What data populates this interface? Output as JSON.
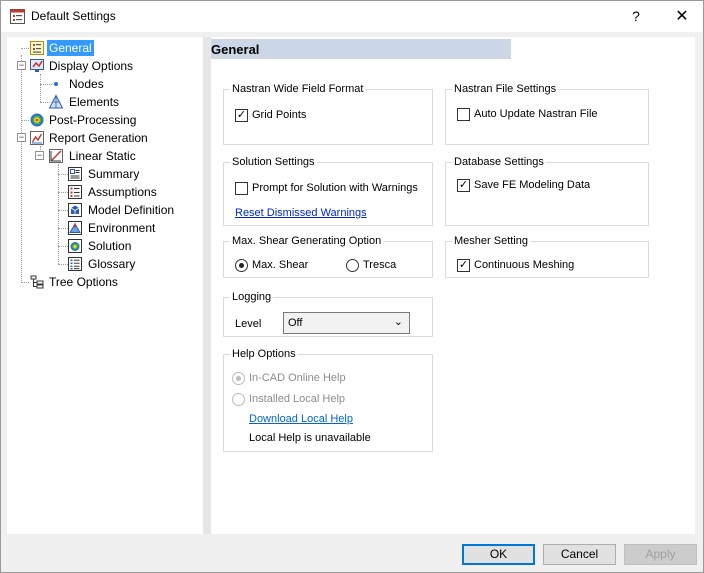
{
  "window": {
    "title": "Default Settings",
    "help_glyph": "?",
    "close_glyph": "✕"
  },
  "tree": {
    "items": [
      {
        "label": "General",
        "icon": "general-settings-icon",
        "selected": true
      },
      {
        "label": "Display Options",
        "icon": "display-options-icon"
      },
      {
        "label": "Nodes",
        "icon": "node-dot-icon"
      },
      {
        "label": "Elements",
        "icon": "elements-icon"
      },
      {
        "label": "Post-Processing",
        "icon": "post-processing-icon"
      },
      {
        "label": "Report Generation",
        "icon": "report-generation-icon"
      },
      {
        "label": "Linear Static",
        "icon": "linear-static-icon"
      },
      {
        "label": "Summary",
        "icon": "summary-icon"
      },
      {
        "label": "Assumptions",
        "icon": "assumptions-icon"
      },
      {
        "label": "Model Definition",
        "icon": "model-definition-icon"
      },
      {
        "label": "Environment",
        "icon": "environment-icon"
      },
      {
        "label": "Solution",
        "icon": "solution-icon"
      },
      {
        "label": "Glossary",
        "icon": "glossary-icon"
      },
      {
        "label": "Tree Options",
        "icon": "tree-options-icon"
      }
    ]
  },
  "page": {
    "header": "General",
    "nastran_wide": {
      "legend": "Nastran Wide Field Format",
      "grid_points_label": "Grid Points",
      "grid_points_checked": true
    },
    "nastran_file": {
      "legend": "Nastran File Settings",
      "auto_update_label": "Auto Update Nastran File",
      "auto_update_checked": false
    },
    "solution": {
      "legend": "Solution Settings",
      "prompt_label": "Prompt for Solution with Warnings",
      "prompt_checked": false,
      "reset_link": "Reset Dismissed Warnings"
    },
    "database": {
      "legend": "Database Settings",
      "save_fe_label": "Save FE Modeling Data",
      "save_fe_checked": true
    },
    "shear": {
      "legend": "Max. Shear Generating Option",
      "max_shear_label": "Max. Shear",
      "tresca_label": "Tresca",
      "selected": "Max. Shear"
    },
    "mesher": {
      "legend": "Mesher Setting",
      "continuous_label": "Continuous Meshing",
      "continuous_checked": true
    },
    "logging": {
      "legend": "Logging",
      "level_label": "Level",
      "level_value": "Off"
    },
    "help": {
      "legend": "Help Options",
      "online_label": "In-CAD Online Help",
      "local_label": "Installed Local Help",
      "download_link": "Download Local Help",
      "status": "Local Help is unavailable",
      "selected": "In-CAD Online Help"
    }
  },
  "buttons": {
    "ok": "OK",
    "cancel": "Cancel",
    "apply": "Apply"
  },
  "glyphs": {
    "check": "✓",
    "dropdown": "⌄",
    "expand_minus": "−"
  }
}
